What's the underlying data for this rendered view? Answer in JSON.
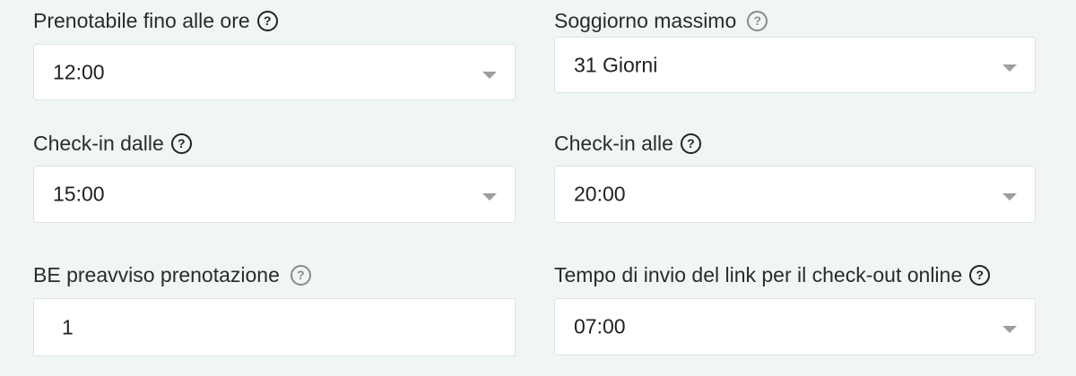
{
  "fields": {
    "prenotabile": {
      "label": "Prenotabile fino alle ore",
      "value": "12:00"
    },
    "soggiorno": {
      "label": "Soggiorno massimo",
      "value": "31 Giorni"
    },
    "checkin_dalle": {
      "label": "Check-in dalle",
      "value": "15:00"
    },
    "checkin_alle": {
      "label": "Check-in alle",
      "value": "20:00"
    },
    "be_preavviso": {
      "label": "BE preavviso prenotazione",
      "value": "1"
    },
    "checkout_link": {
      "label": "Tempo di invio del link per il check-out online",
      "value": "07:00"
    }
  },
  "icons": {
    "help": "question-circle-icon",
    "dropdown": "chevron-down-icon"
  },
  "help_glyph": "?"
}
